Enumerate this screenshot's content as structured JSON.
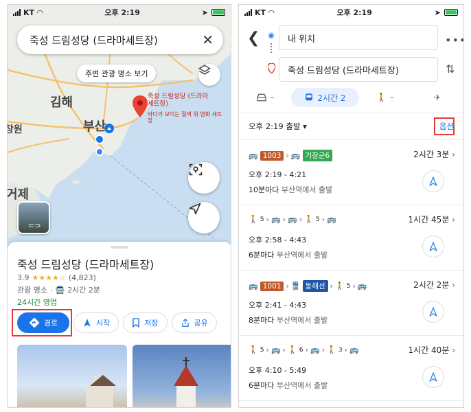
{
  "left": {
    "status": {
      "carrier": "KT",
      "time": "오후 2:19"
    },
    "search": {
      "query": "죽성 드림성당 (드라마세트장)"
    },
    "map": {
      "nearby_chip": "주변 관광 명소 보기",
      "labels": {
        "gimhae": "김해",
        "busan": "부산",
        "changwon": "창원",
        "geoje": "거제"
      },
      "pin_title": "죽성 드림성당 (드라마세트장)",
      "pin_subtitle": "바다가 보이는 절벽 위 영화 세트장"
    },
    "sheet": {
      "title": "죽성 드림성당 (드라마세트장)",
      "rating": "3.9",
      "stars": "★★★★☆",
      "reviews": "(4,823)",
      "category": "관광 명소",
      "transit_time": "2시간 2분",
      "hours": "24시간 영업",
      "actions": {
        "directions": "경로",
        "start": "시작",
        "save": "저장",
        "share": "공유"
      }
    }
  },
  "right": {
    "status": {
      "carrier": "KT",
      "time": "오후 2:19"
    },
    "origin": "내 위치",
    "destination": "죽성 드림성당 (드라마세트장)",
    "modes": {
      "car": "–",
      "transit": "2시간 2",
      "walk": "–"
    },
    "depart": "오후 2:19 출발",
    "options": "옵션",
    "routes": [
      {
        "badge1": "1003",
        "badge2": "기장군6",
        "duration": "2시간 3분",
        "times": "오후 2:19 - 4:21",
        "freq": "10분마다",
        "from": "부산역에서 출발"
      },
      {
        "walk1": "5",
        "walk2": "5",
        "duration": "1시간 45분",
        "times": "오후 2:58 - 4:43",
        "freq": "6분마다",
        "from": "부산역에서 출발"
      },
      {
        "badge1": "1001",
        "badge2": "동해선",
        "walk1": "5",
        "duration": "2시간 2분",
        "times": "오후 2:41 - 4:43",
        "freq": "8분마다",
        "from": "부산역에서 출발"
      },
      {
        "walk1": "5",
        "walk2": "6",
        "walk3": "3",
        "duration": "1시간 40분",
        "times": "오후 4:10 - 5:49",
        "freq": "6분마다",
        "from": "부산역에서 출발"
      }
    ],
    "colors": {
      "bus_orange": "#c0592b",
      "bus_green": "#33a853",
      "rail_blue": "#1d56a5"
    }
  }
}
